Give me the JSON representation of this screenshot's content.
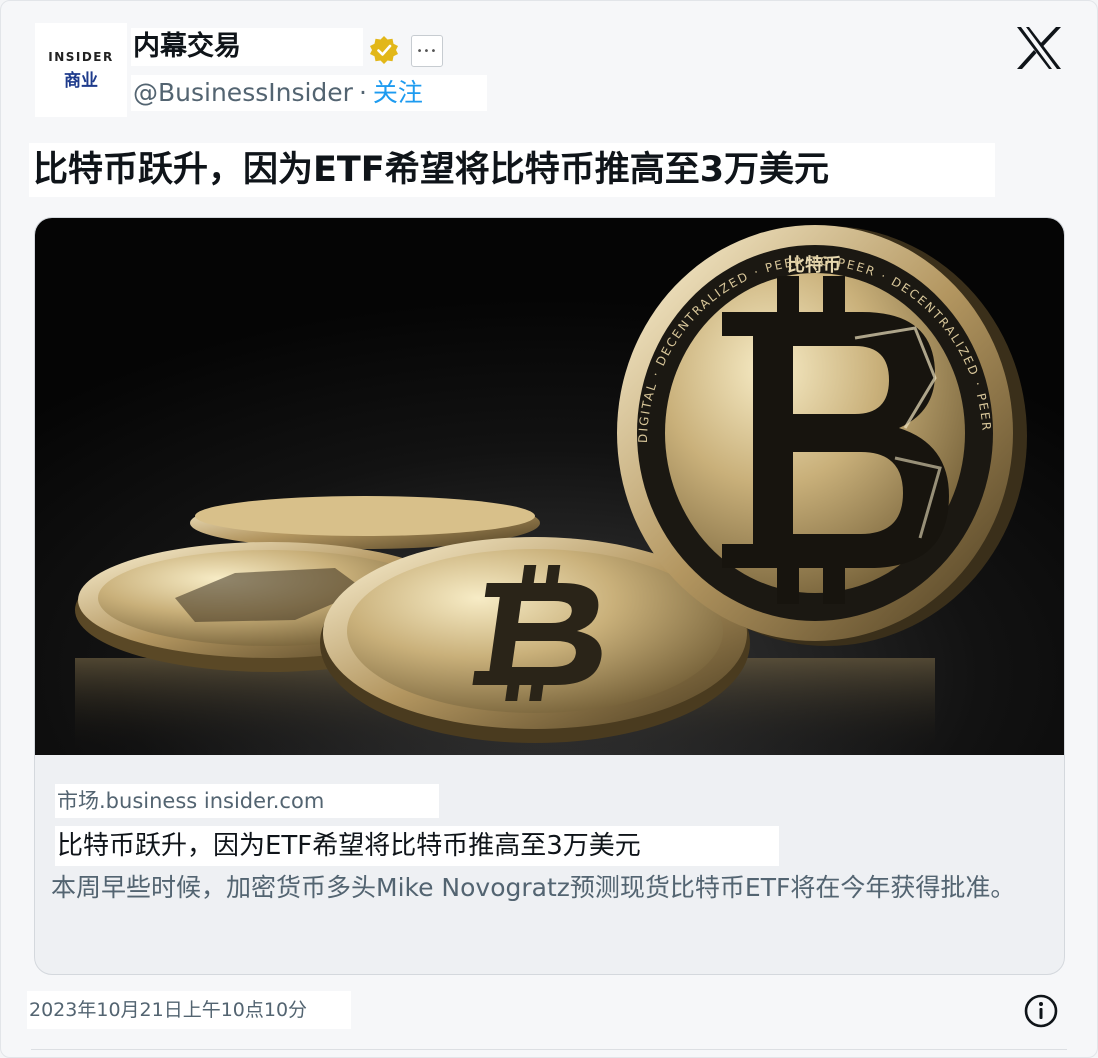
{
  "account": {
    "avatar_line1": "INSIDER",
    "avatar_line2": "商业",
    "name": "内幕交易",
    "handle": "@BusinessInsider",
    "separator": "·",
    "follow_label": "关注"
  },
  "tweet": {
    "title": "比特币跃升，因为ETF希望将比特币推高至3万美元",
    "timestamp": "2023年10月21日上午10点10分"
  },
  "image": {
    "coin_top_text": "比特币",
    "coin_ring_text": "DIGITAL · DECENTRALIZED · PEER TO PEER · DECENTRALIZED · PEER TO PEER ·"
  },
  "link_card": {
    "domain": "市场.business insider.com",
    "title": "比特币跃升，因为ETF希望将比特币推高至3万美元",
    "description": "本周早些时候，加密货币多头Mike Novogratz预测现货比特币ETF将在今年获得批准。"
  },
  "colors": {
    "verified_badge": "#e2b719",
    "follow_link": "#1d9bf0",
    "muted_text": "#536471"
  },
  "icons": {
    "verified": "verified-badge-icon",
    "more": "more-options-icon",
    "platform": "x-logo-icon",
    "info": "info-icon"
  }
}
